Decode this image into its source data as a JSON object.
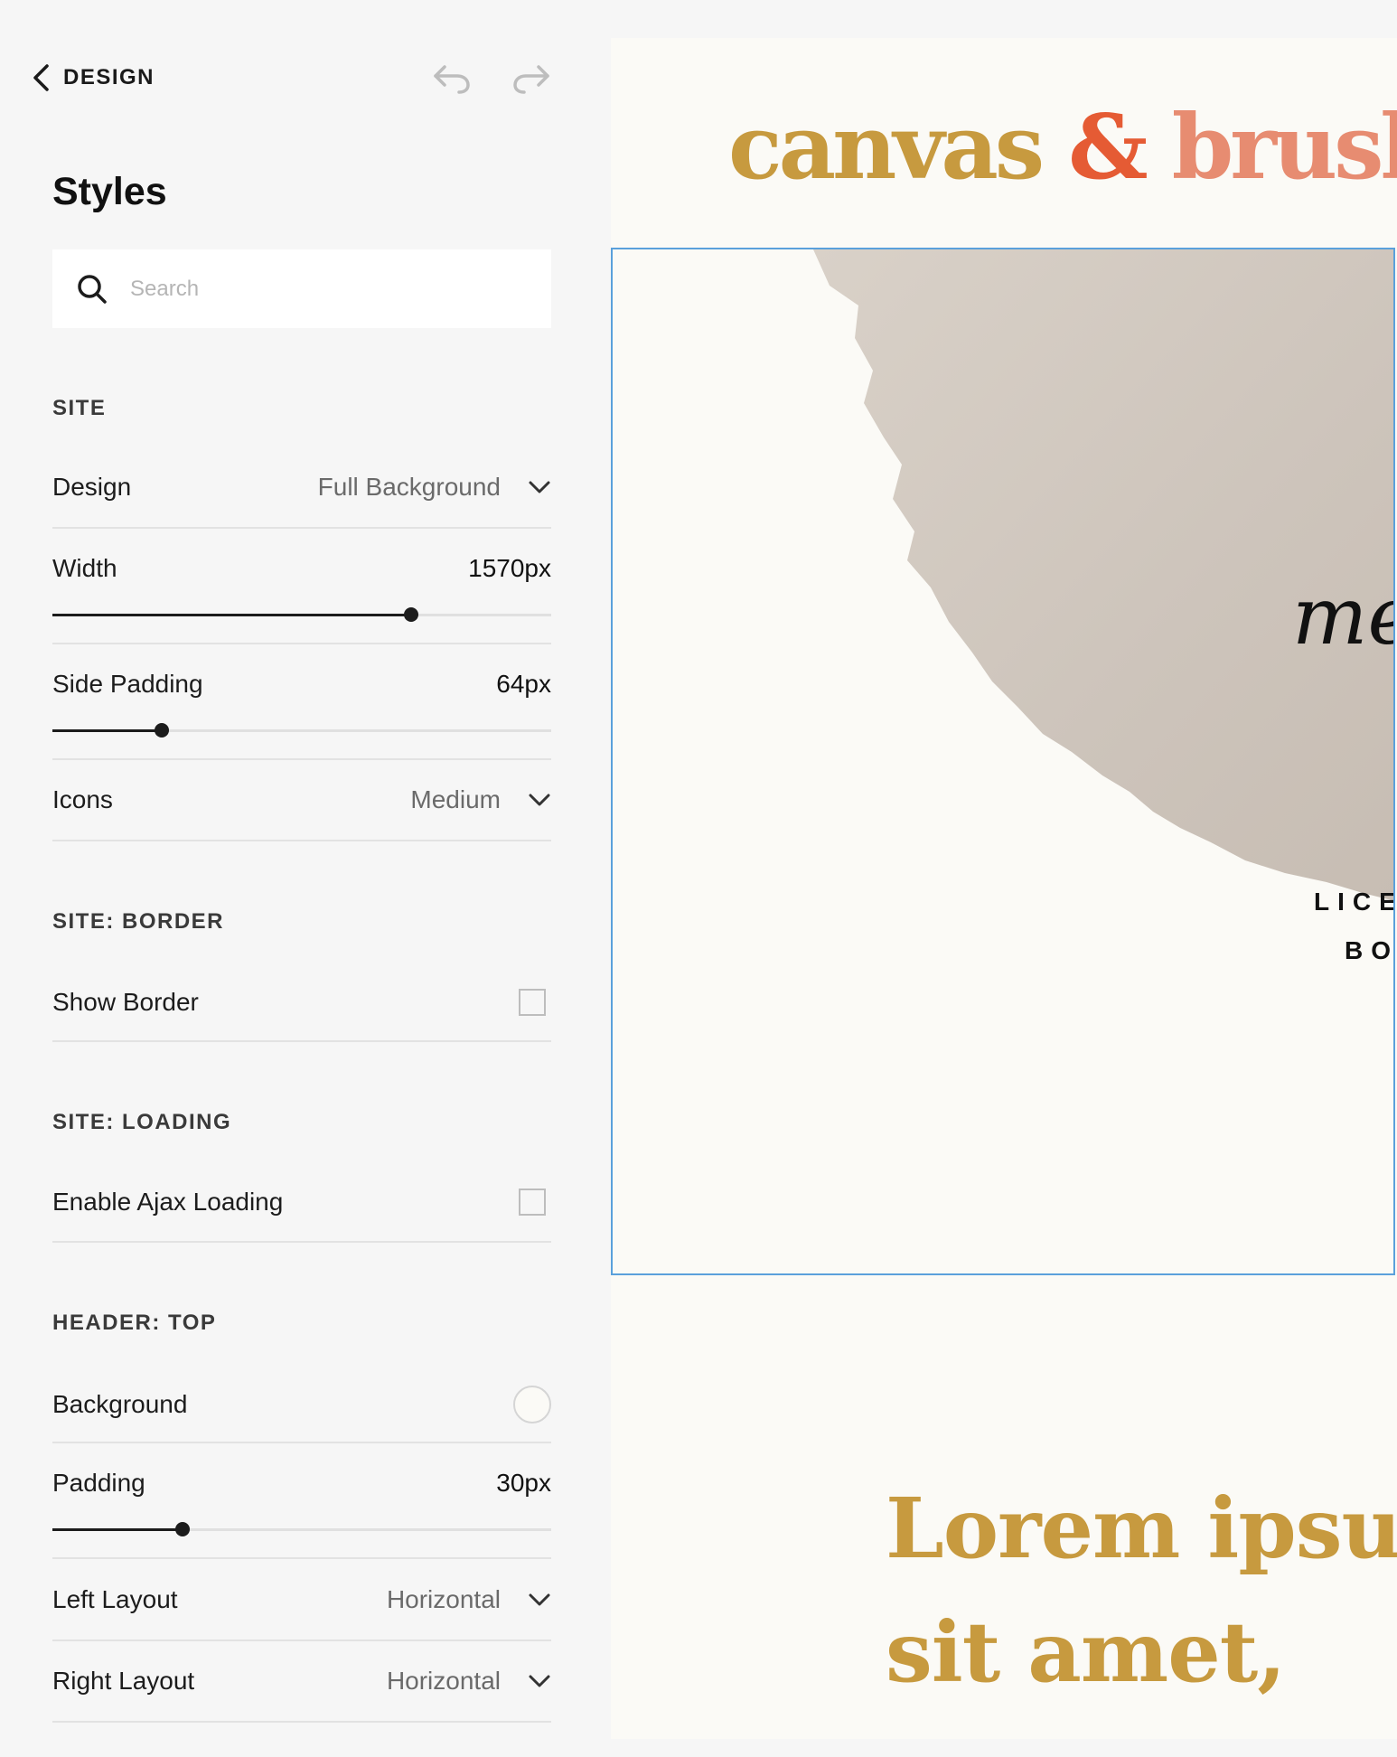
{
  "panel": {
    "back_label": "DESIGN",
    "title": "Styles",
    "search_placeholder": "Search"
  },
  "site": {
    "heading": "SITE",
    "design_label": "Design",
    "design_value": "Full Background",
    "width_label": "Width",
    "width_value": "1570px",
    "width_fraction": 0.72,
    "side_padding_label": "Side Padding",
    "side_padding_value": "64px",
    "side_padding_fraction": 0.22,
    "icons_label": "Icons",
    "icons_value": "Medium"
  },
  "border": {
    "heading": "SITE: BORDER",
    "show_border_label": "Show Border",
    "show_border_checked": false
  },
  "loading": {
    "heading": "SITE: LOADING",
    "ajax_label": "Enable Ajax Loading",
    "ajax_checked": false
  },
  "header_top": {
    "heading": "HEADER: TOP",
    "background_label": "Background",
    "background_color": "#fbfaf6",
    "padding_label": "Padding",
    "padding_value": "30px",
    "padding_fraction": 0.26,
    "left_layout_label": "Left Layout",
    "left_layout_value": "Horizontal",
    "right_layout_label": "Right Layout",
    "right_layout_value": "Horizontal"
  },
  "preview": {
    "logo_part1": "canvas",
    "logo_part2": "&",
    "logo_part3": "brush",
    "hero_script": "me",
    "hero_line1": "LICE",
    "hero_line2": "BO",
    "lorem_line1": "Lorem ipsum",
    "lorem_line2": "sit amet,"
  },
  "colors": {
    "gold": "#c79a3f",
    "orange": "#e55b34",
    "salmon": "#e78c71",
    "selection": "#5aa0db"
  }
}
